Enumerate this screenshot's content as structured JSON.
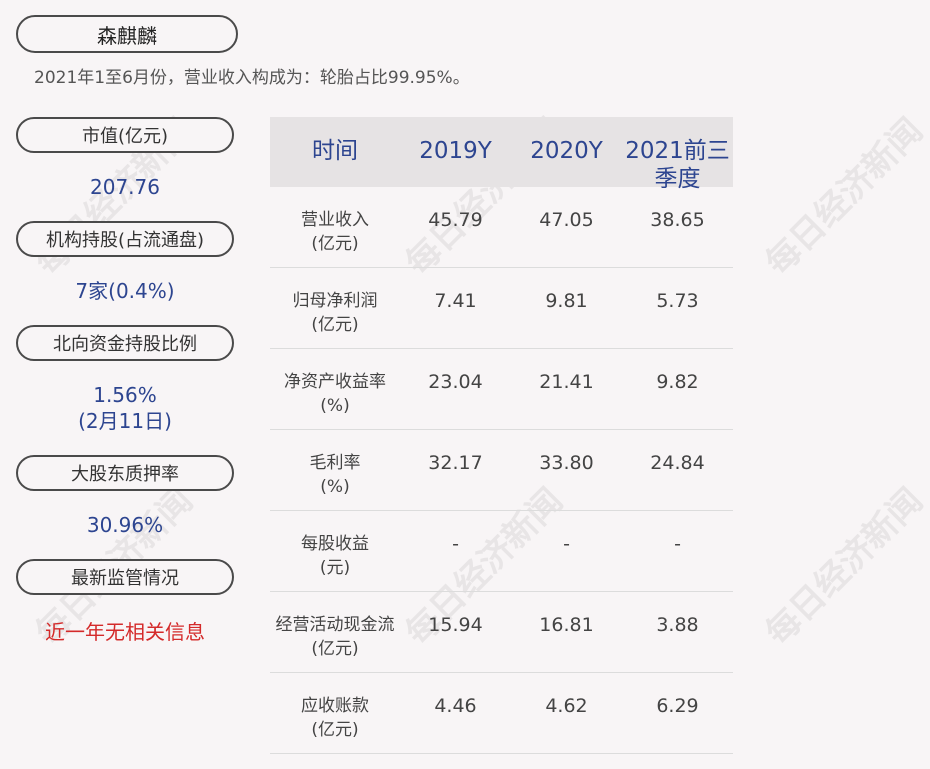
{
  "header": {
    "company": "森麒麟",
    "subtitle": "2021年1至6月份，营业收入构成为：轮胎占比99.95%。"
  },
  "metrics": [
    {
      "label": "市值(亿元)",
      "value": "207.76"
    },
    {
      "label": "机构持股(占流通盘)",
      "value": "7家(0.4%)"
    },
    {
      "label": "北向资金持股比例",
      "value": "1.56%",
      "value2": "(2月11日)"
    },
    {
      "label": "大股东质押率",
      "value": "30.96%"
    },
    {
      "label": "最新监管情况",
      "value": "近一年无相关信息"
    }
  ],
  "table": {
    "headers": [
      "时间",
      "2019Y",
      "2020Y",
      "2021前三",
      "季度"
    ],
    "rows": [
      {
        "label": "营业收入",
        "unit": "(亿元)",
        "v": [
          "45.79",
          "47.05",
          "38.65"
        ]
      },
      {
        "label": "归母净利润",
        "unit": "(亿元)",
        "v": [
          "7.41",
          "9.81",
          "5.73"
        ]
      },
      {
        "label": "净资产收益率",
        "unit": "(%)",
        "v": [
          "23.04",
          "21.41",
          "9.82"
        ]
      },
      {
        "label": "毛利率",
        "unit": "(%)",
        "v": [
          "32.17",
          "33.80",
          "24.84"
        ]
      },
      {
        "label": "每股收益",
        "unit": "(元)",
        "v": [
          "-",
          "-",
          "-"
        ]
      },
      {
        "label": "经营活动现金流",
        "unit": "(亿元)",
        "v": [
          "15.94",
          "16.81",
          "3.88"
        ]
      },
      {
        "label": "应收账款",
        "unit": "(亿元)",
        "v": [
          "4.46",
          "4.62",
          "6.29"
        ]
      }
    ]
  },
  "watermark": "每日经济新闻"
}
